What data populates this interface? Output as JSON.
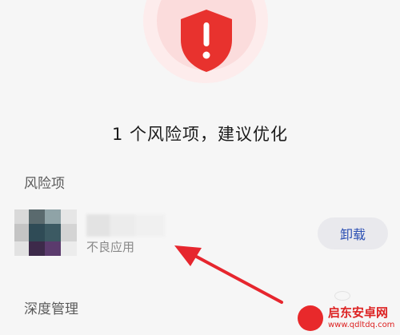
{
  "header": {
    "risk_summary": "1 个风险项，建议优化"
  },
  "sections": {
    "risk": {
      "title": "风险项",
      "items": [
        {
          "name_blurred": "",
          "subtitle": "不良应用",
          "action_label": "卸载"
        }
      ]
    },
    "deep": {
      "title": "深度管理"
    }
  },
  "icons": {
    "shield": "shield-alert-icon",
    "arrow": "annotation-arrow"
  },
  "colors": {
    "danger": "#e8322e",
    "accent_text": "#2b4fb3",
    "button_bg": "#e9e9ed",
    "arrow": "#e6262e"
  },
  "watermark": {
    "title": "启东安卓网",
    "url": "www.qdltdq.com"
  }
}
